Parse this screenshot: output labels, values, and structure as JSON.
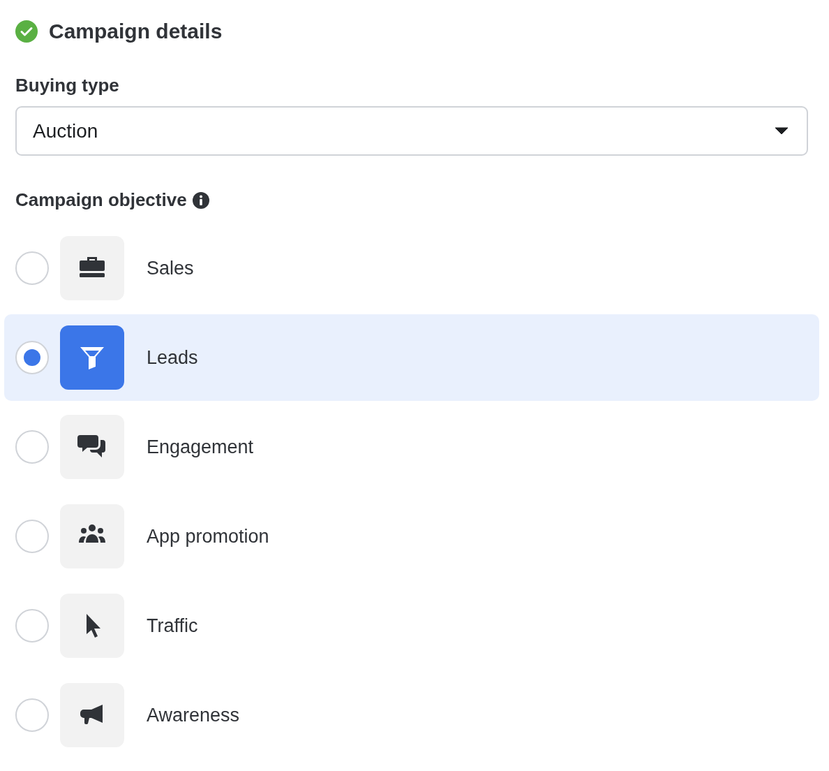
{
  "header": {
    "title": "Campaign details",
    "complete": true
  },
  "buying_type": {
    "label": "Buying type",
    "value": "Auction"
  },
  "objective": {
    "label": "Campaign objective",
    "options": [
      {
        "label": "Sales",
        "kind": "sales",
        "selected": false
      },
      {
        "label": "Leads",
        "kind": "leads",
        "selected": true
      },
      {
        "label": "Engagement",
        "kind": "engagement",
        "selected": false
      },
      {
        "label": "App promotion",
        "kind": "app",
        "selected": false
      },
      {
        "label": "Traffic",
        "kind": "traffic",
        "selected": false
      },
      {
        "label": "Awareness",
        "kind": "awareness",
        "selected": false
      }
    ]
  }
}
